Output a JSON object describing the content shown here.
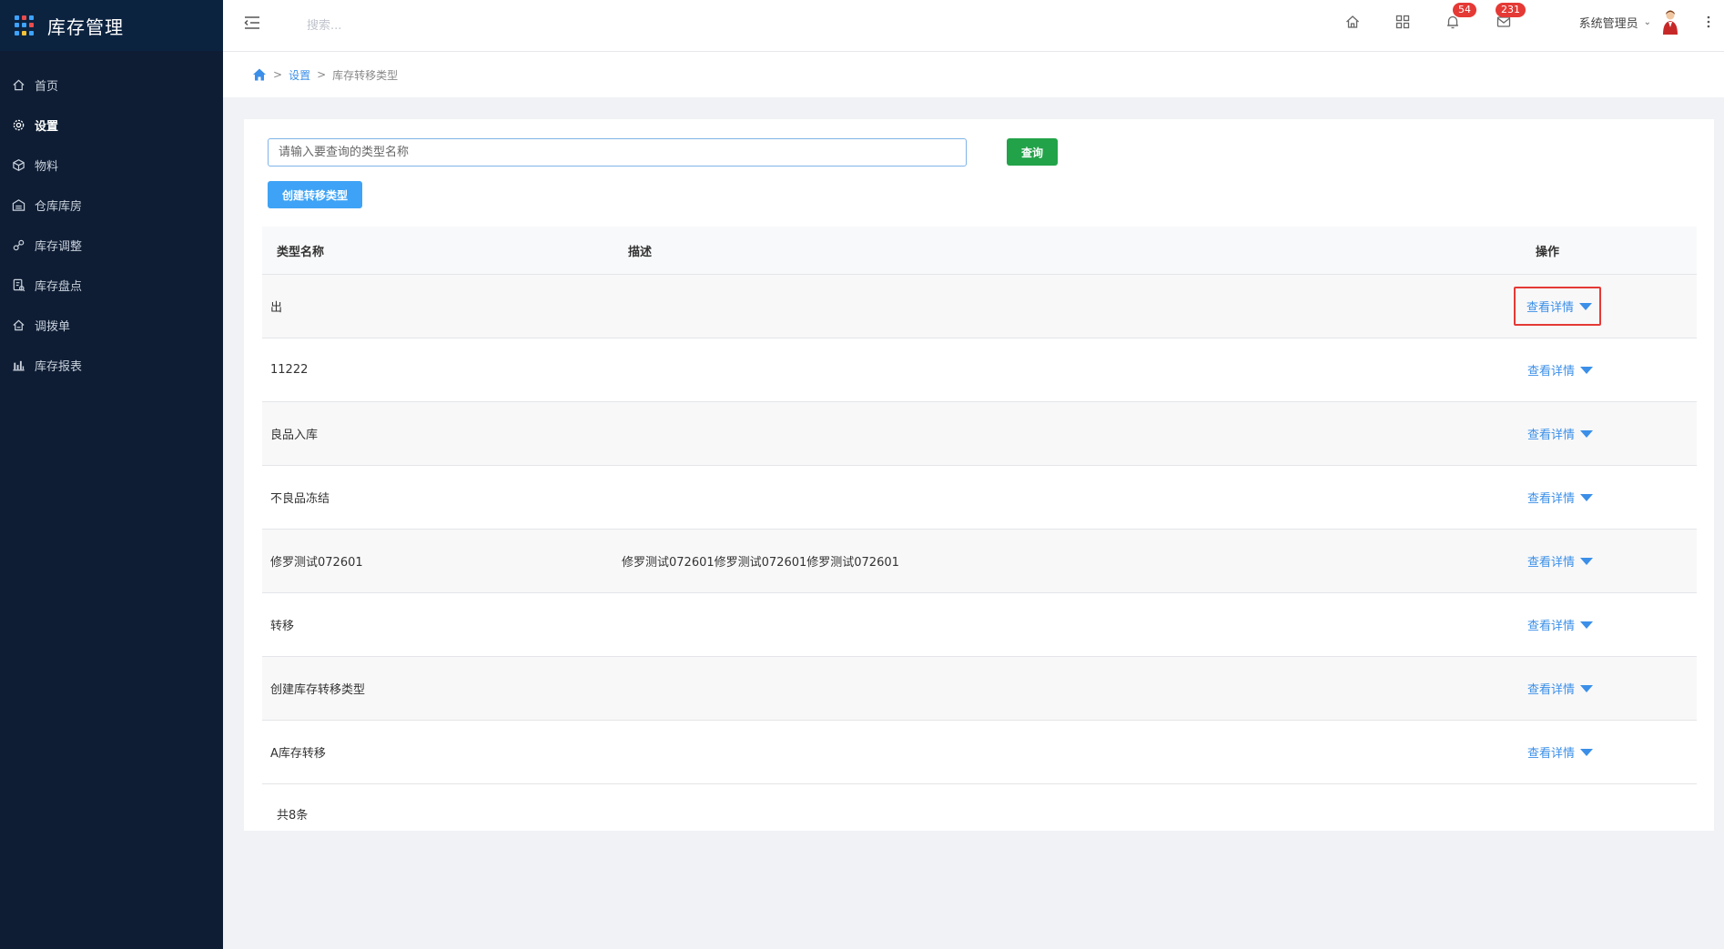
{
  "app": {
    "title": "库存管理"
  },
  "sidebar": {
    "items": [
      {
        "label": "首页",
        "icon": "home-icon"
      },
      {
        "label": "设置",
        "icon": "gear-icon",
        "active": true
      },
      {
        "label": "物料",
        "icon": "cube-icon"
      },
      {
        "label": "仓库库房",
        "icon": "warehouse-icon"
      },
      {
        "label": "库存调整",
        "icon": "adjust-icon"
      },
      {
        "label": "库存盘点",
        "icon": "inventory-check-icon"
      },
      {
        "label": "调拨单",
        "icon": "transfer-icon"
      },
      {
        "label": "库存报表",
        "icon": "bar-chart-icon"
      }
    ]
  },
  "header": {
    "search_placeholder": "搜索...",
    "notifications_count": "54",
    "messages_count": "231",
    "user_name": "系统管理员"
  },
  "breadcrumb": {
    "items": [
      "设置",
      "库存转移类型"
    ]
  },
  "toolbar": {
    "query_placeholder": "请输入要查询的类型名称",
    "query_label": "查询",
    "create_label": "创建转移类型"
  },
  "table": {
    "headers": {
      "name": "类型名称",
      "desc": "描述",
      "op": "操作"
    },
    "detail_label": "查看详情",
    "rows": [
      {
        "name": "出",
        "desc": ""
      },
      {
        "name": "11222",
        "desc": ""
      },
      {
        "name": "良品入库",
        "desc": ""
      },
      {
        "name": "不良品冻结",
        "desc": ""
      },
      {
        "name": "修罗测试072601",
        "desc": "修罗测试072601修罗测试072601修罗测试072601"
      },
      {
        "name": "转移",
        "desc": ""
      },
      {
        "name": "创建库存转移类型",
        "desc": ""
      },
      {
        "name": "A库存转移",
        "desc": ""
      }
    ],
    "total_text": "共8条"
  },
  "colors": {
    "sidebar_bg": "#0e1d34",
    "link": "#3b8fe8",
    "query_button": "#22a349",
    "create_button": "#3ea3f6",
    "badge": "#e53935",
    "highlight_border": "#e53935"
  }
}
